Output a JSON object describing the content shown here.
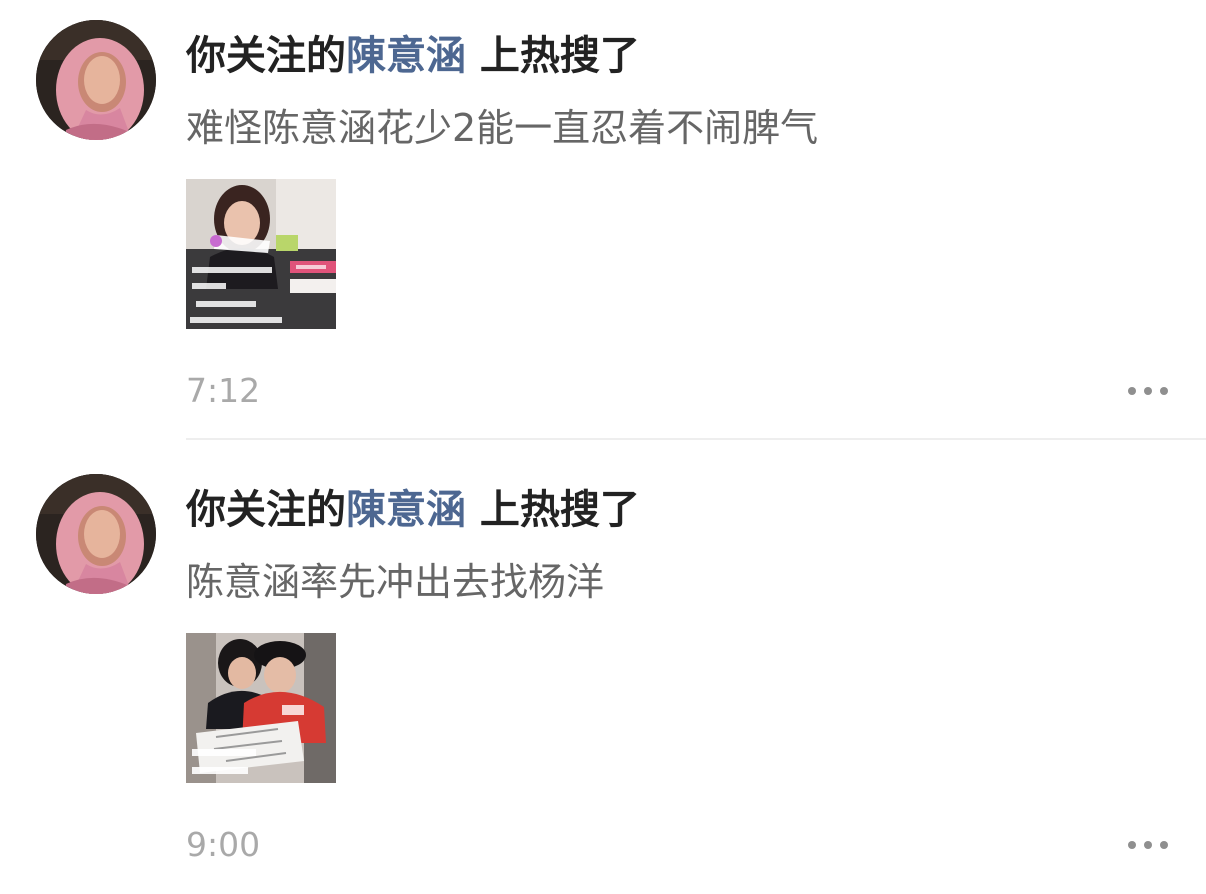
{
  "posts": [
    {
      "headline_prefix": "你关注的",
      "celebrity": "陳意涵",
      "headline_suffix": " 上热搜了",
      "subtitle": "难怪陈意涵花少2能一直忍着不闹脾气",
      "time": "7:12",
      "thumbnail_icon": "video-thumbnail-woman-interview",
      "more_icon": "more-dots-icon"
    },
    {
      "headline_prefix": "你关注的",
      "celebrity": "陳意涵",
      "headline_suffix": " 上热搜了",
      "subtitle": "陈意涵率先冲出去找杨洋",
      "time": "9:00",
      "thumbnail_icon": "video-thumbnail-two-people-map",
      "more_icon": "more-dots-icon"
    }
  ],
  "colors": {
    "celebrity_link": "#4d6791",
    "headline": "#222222",
    "subtitle": "#666666",
    "timestamp": "#a9a9a9",
    "divider": "#eeeeee"
  }
}
